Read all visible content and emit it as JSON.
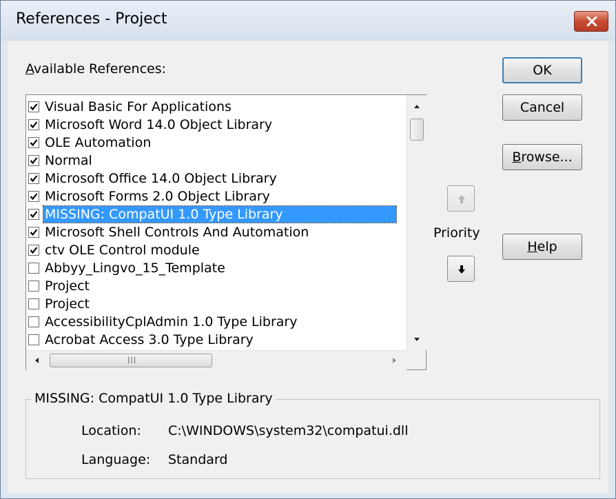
{
  "window": {
    "title": "References - Project"
  },
  "available_references": {
    "label_prefix": "",
    "label_accel": "A",
    "label_rest": "vailable References:",
    "items": [
      {
        "label": "Visual Basic For Applications",
        "checked": true
      },
      {
        "label": "Microsoft Word 14.0 Object Library",
        "checked": true
      },
      {
        "label": "OLE Automation",
        "checked": true
      },
      {
        "label": "Normal",
        "checked": true
      },
      {
        "label": "Microsoft Office 14.0 Object Library",
        "checked": true
      },
      {
        "label": "Microsoft Forms 2.0 Object Library",
        "checked": true
      },
      {
        "label": "MISSING: CompatUI 1.0 Type Library",
        "checked": true,
        "selected": true
      },
      {
        "label": "Microsoft Shell Controls And Automation",
        "checked": true
      },
      {
        "label": "ctv OLE Control module",
        "checked": true
      },
      {
        "label": "Abbyy_Lingvo_15_Template",
        "checked": false
      },
      {
        "label": "Project",
        "checked": false
      },
      {
        "label": "Project",
        "checked": false
      },
      {
        "label": "AccessibilityCplAdmin 1.0 Type Library",
        "checked": false
      },
      {
        "label": "Acrobat Access 3.0 Type Library",
        "checked": false
      }
    ]
  },
  "buttons": {
    "ok": "OK",
    "cancel": "Cancel",
    "browse_accel": "B",
    "browse_rest": "rowse...",
    "help_accel": "H",
    "help_rest": "elp"
  },
  "priority": {
    "label": "Priority",
    "up_icon": "arrow-up-icon",
    "down_icon": "arrow-down-icon"
  },
  "details": {
    "title": "MISSING: CompatUI 1.0 Type Library",
    "location_label": "Location:",
    "location_value": "C:\\WINDOWS\\system32\\compatui.dll",
    "language_label": "Language:",
    "language_value": "Standard"
  },
  "colors": {
    "selection": "#3399ff",
    "close_button": "#c74b33"
  }
}
